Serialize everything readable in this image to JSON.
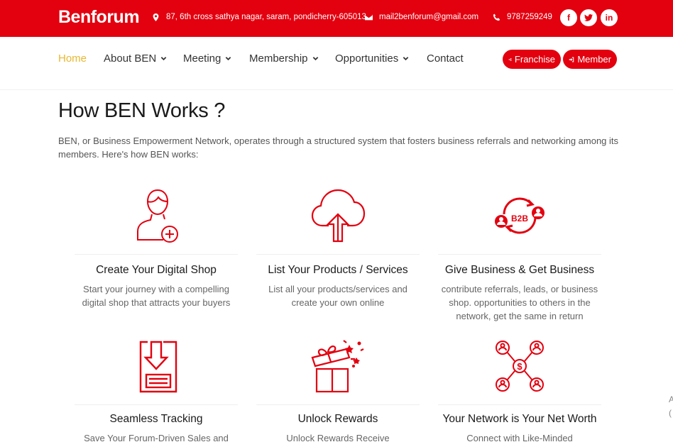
{
  "header": {
    "brand": "Benforum",
    "address": "87, 6th cross sathya nagar, saram, pondicherry-605013",
    "email": "mail2benforum@gmail.com",
    "phone": "9787259249",
    "social": {
      "facebook": "f",
      "linkedin": "in"
    },
    "icons": [
      "map-marker-icon",
      "envelope-icon",
      "phone-icon",
      "facebook-icon",
      "twitter-icon",
      "linkedin-icon"
    ]
  },
  "nav": {
    "items": [
      {
        "label": "Home",
        "active": true
      },
      {
        "label": "About BEN",
        "dropdown": true
      },
      {
        "label": "Meeting",
        "dropdown": true
      },
      {
        "label": "Membership",
        "dropdown": true
      },
      {
        "label": "Opportunities",
        "dropdown": true
      },
      {
        "label": "Contact"
      }
    ],
    "buttons": {
      "franchise": "Franchise",
      "member": "Member"
    }
  },
  "main": {
    "title": "How BEN Works ?",
    "intro": "BEN, or Business Empowerment Network, operates through a structured system that fosters business referrals and networking among its members. Here's how BEN works:",
    "cards": [
      {
        "title": "Create Your Digital Shop",
        "desc": "Start your journey with a compelling digital shop that attracts your buyers",
        "icon": "user-add-icon"
      },
      {
        "title": "List Your Products / Services",
        "desc": "List all your products/services and create your own online",
        "icon": "cloud-upload-icon"
      },
      {
        "title": "Give Business & Get Business",
        "desc": "contribute referrals, leads, or business shop. opportunities to others in the network, get the same in return",
        "icon": "b2b-exchange-icon",
        "badge": "B2B"
      },
      {
        "title": "Seamless Tracking",
        "desc": "Save Your Forum-Driven Sales and",
        "icon": "download-tracking-icon"
      },
      {
        "title": "Unlock Rewards",
        "desc": "Unlock Rewards Receive complimentary",
        "icon": "gift-box-icon"
      },
      {
        "title": "Your Network is Your Net Worth",
        "desc": "Connect with Like-Minded",
        "icon": "network-dollar-icon"
      }
    ]
  },
  "edge": {
    "letter1": "A",
    "letter2": "("
  },
  "colors": {
    "primary": "#e3000f",
    "active_nav": "#e8b830",
    "text": "#333333",
    "muted": "#666666"
  }
}
